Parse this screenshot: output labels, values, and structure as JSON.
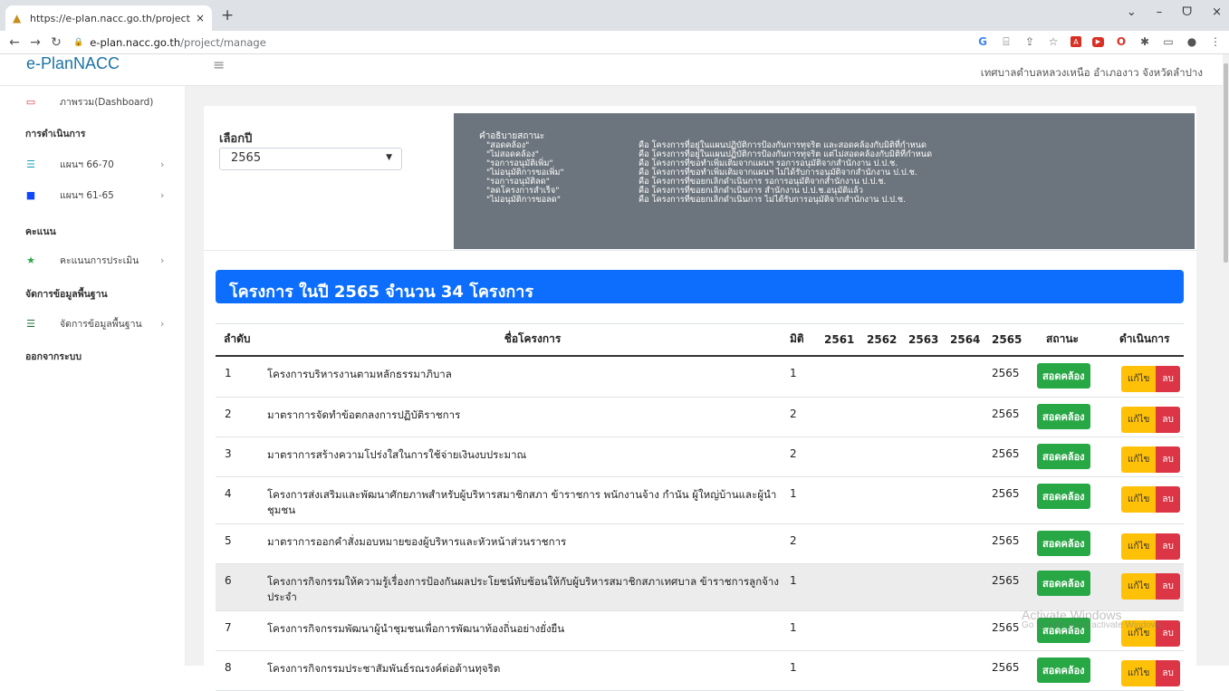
{
  "browser": {
    "tab_title": "https://e-plan.nacc.go.th/project",
    "url_host": "e-plan.nacc.go.th",
    "url_path": "/project/manage",
    "new_tab": "+",
    "close": "×",
    "win_min": "–",
    "win_max": "ᗜ",
    "win_close": "×"
  },
  "header": {
    "brand": "e-PlanNACC",
    "org": "เทศบาลตำบลหลวงเหนือ อำเภองาว จังหวัดลำปาง"
  },
  "sidebar": {
    "dashboard": "ภาพรวม(Dashboard)",
    "section_ops": "การดำเนินการ",
    "plan_66_70": "แผนฯ 66-70",
    "plan_61_65": "แผนฯ 61-65",
    "section_score": "คะแนน",
    "score_eval": "คะแนนการประเมิน",
    "section_base": "จัดการข้อมูลพื้นฐาน",
    "base_manage": "จัดการข้อมูลพื้นฐาน",
    "logout": "ออกจากระบบ"
  },
  "filter": {
    "label": "เลือกปี",
    "selected_year": "2565"
  },
  "legend": {
    "title": "คำอธิบายสถานะ",
    "rows": [
      {
        "k": "\"สอดคล้อง\"",
        "v": "คือ โครงการที่อยู่ในแผนปฏิบัติการป้องกันการทุจริต และสอดคล้องกับมิติที่กำหนด"
      },
      {
        "k": "\"ไม่สอดคล้อง\"",
        "v": "คือ โครงการที่อยู่ในแผนปฏิบัติการป้องกันการทุจริต แต่ไม่สอดคล้องกับมิติที่กำหนด"
      },
      {
        "k": "\"รอการอนุมัติเพิ่ม\"",
        "v": "คือ โครงการที่ขอทำเพิ่มเติมจากแผนฯ รอการอนุมัติจากสำนักงาน ป.ป.ช."
      },
      {
        "k": "\"ไม่อนุมัติการขอเพิ่ม\"",
        "v": "คือ โครงการที่ขอทำเพิ่มเติมจากแผนฯ ไม่ได้รับการอนุมัติจากสำนักงาน ป.ป.ช."
      },
      {
        "k": "\"รอการอนุมัติลด\"",
        "v": "คือ โครงการที่ขอยกเลิกดำเนินการ รอการอนุมัติจากสำนักงาน ป.ป.ช."
      },
      {
        "k": "\"ลดโครงการสำเร็จ\"",
        "v": "คือ โครงการที่ขอยกเลิกดำเนินการ สำนักงาน ป.ป.ช.อนุมัติแล้ว"
      },
      {
        "k": "\"ไม่อนุมัติการขอลด\"",
        "v": "คือ โครงการที่ขอยกเลิกดำเนินการ ไม่ได้รับการอนุมัติจากสำนักงาน ป.ป.ช."
      }
    ]
  },
  "banner": "โครงการ ในปี 2565 จำนวน 34 โครงการ",
  "table": {
    "headers": {
      "no": "ลำดับ",
      "name": "ชื่อโครงการ",
      "dim": "มิติ",
      "y2561": "2561",
      "y2562": "2562",
      "y2563": "2563",
      "y2564": "2564",
      "y2565": "2565",
      "status": "สถานะ",
      "action": "ดำเนินการ"
    },
    "edit_label": "แก้ไข",
    "delete_label": "ลบ",
    "rows": [
      {
        "no": "1",
        "name": "โครงการบริหารงานตามหลักธรรมาภิบาล",
        "dim": "1",
        "y2565": "2565",
        "status": "สอดคล้อง"
      },
      {
        "no": "2",
        "name": "มาตราการจัดทำข้อตกลงการปฏิบัติราชการ",
        "dim": "2",
        "y2565": "2565",
        "status": "สอดคล้อง"
      },
      {
        "no": "3",
        "name": "มาตราการสร้างความโปร่งใสในการใช้จ่ายเงินงบประมาณ",
        "dim": "2",
        "y2565": "2565",
        "status": "สอดคล้อง"
      },
      {
        "no": "4",
        "name": "โครงการส่งเสริมและพัฒนาศักยภาพสำหรับผู้บริหารสมาชิกสภา ข้าราชการ พนักงานจ้าง กำนัน ผู้ใหญ่บ้านและผู้นำชุมชน",
        "dim": "1",
        "y2565": "2565",
        "status": "สอดคล้อง"
      },
      {
        "no": "5",
        "name": "มาตราการออกคำสั่งมอบหมายของผู้บริหารและหัวหน้าส่วนราชการ",
        "dim": "2",
        "y2565": "2565",
        "status": "สอดคล้อง"
      },
      {
        "no": "6",
        "name": "โครงการกิจกรรมให้ความรู้เรื่องการป้องกันผลประโยชน์ทับซ้อนให้กับผู้บริหารสมาชิกสภาเทศบาล ข้าราชการลูกจ้างประจำ",
        "dim": "1",
        "y2565": "2565",
        "status": "สอดคล้อง"
      },
      {
        "no": "7",
        "name": "โครงการกิจกรรมพัฒนาผู้นำชุมชนเพื่อการพัฒนาท้องถิ่นอย่างยั่งยืน",
        "dim": "1",
        "y2565": "2565",
        "status": "สอดคล้อง"
      },
      {
        "no": "8",
        "name": "โครงการกิจกรรมประชาสัมพันธ์รณรงค์ต่อต้านทุจริต",
        "dim": "1",
        "y2565": "2565",
        "status": "สอดคล้อง"
      }
    ]
  },
  "watermark": {
    "line1": "Activate Windows",
    "line2": "Go to Settings to activate Windows."
  }
}
